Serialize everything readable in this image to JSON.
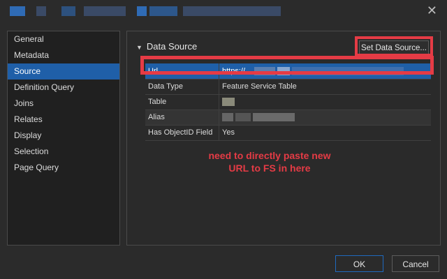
{
  "window": {
    "close_glyph": "✕",
    "redacted_title_colors": [
      "#2f6bb5",
      "#3a4a66",
      "#2f6bb5",
      "#3a4a66",
      "#2f6bb5",
      "#2f6bb5",
      "#3a4a66"
    ]
  },
  "sidebar": {
    "items": [
      {
        "label": "General"
      },
      {
        "label": "Metadata"
      },
      {
        "label": "Source"
      },
      {
        "label": "Definition Query"
      },
      {
        "label": "Joins"
      },
      {
        "label": "Relates"
      },
      {
        "label": "Display"
      },
      {
        "label": "Selection"
      },
      {
        "label": "Page Query"
      }
    ],
    "active_index": 2
  },
  "section": {
    "title": "Data Source",
    "collapse_icon": "chevron-down-icon"
  },
  "set_data_source_button": "Set Data Source...",
  "properties": [
    {
      "key": "Url",
      "value": "https://"
    },
    {
      "key": "Data Type",
      "value": "Feature Service Table"
    },
    {
      "key": "Table",
      "value": ""
    },
    {
      "key": "Alias",
      "value": ""
    },
    {
      "key": "Has ObjectID Field",
      "value": "Yes"
    }
  ],
  "annotation": {
    "line1": "need to directly paste new",
    "line2": "URL to FS in here",
    "color": "#e53b45"
  },
  "footer": {
    "ok_label": "OK",
    "cancel_label": "Cancel"
  },
  "colors": {
    "accent": "#1f5fa8",
    "highlight": "#e53b45",
    "background": "#2b2b2b"
  }
}
